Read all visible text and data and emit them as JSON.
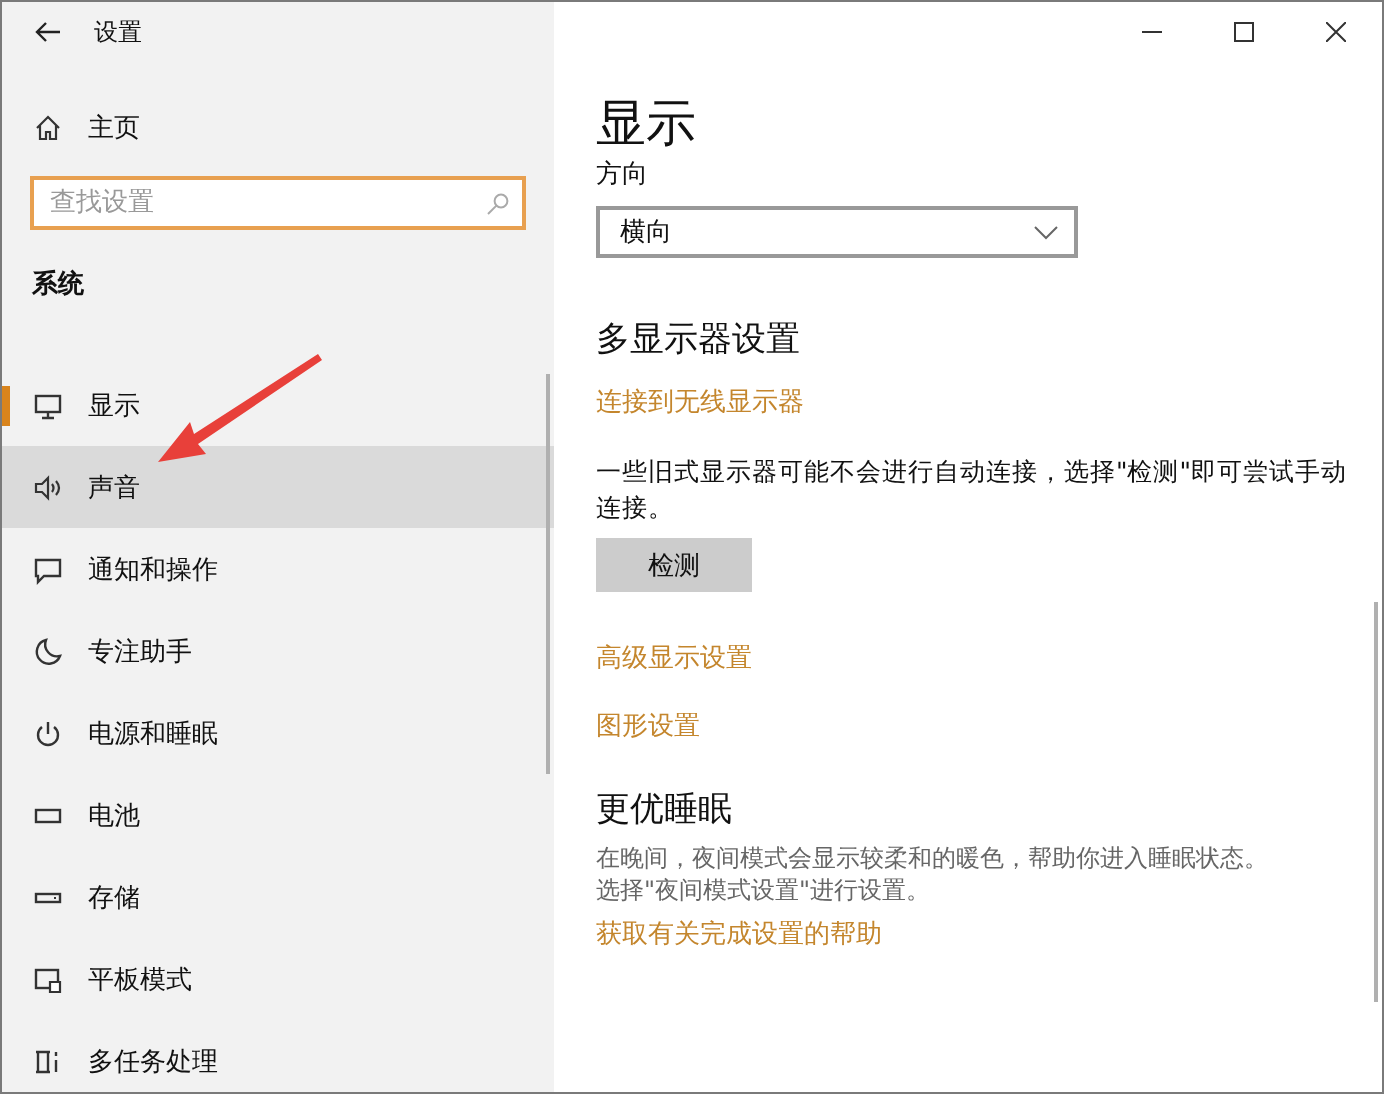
{
  "window": {
    "title": "设置"
  },
  "sidebar": {
    "home": "主页",
    "search": {
      "placeholder": "查找设置",
      "focused": true
    },
    "section": "系统",
    "items": [
      {
        "kind": "monitor",
        "label": "显示",
        "selected": true,
        "hover": false
      },
      {
        "kind": "speaker",
        "label": "声音",
        "selected": false,
        "hover": true
      },
      {
        "kind": "message",
        "label": "通知和操作",
        "selected": false,
        "hover": false
      },
      {
        "kind": "moon",
        "label": "专注助手",
        "selected": false,
        "hover": false
      },
      {
        "kind": "power",
        "label": "电源和睡眠",
        "selected": false,
        "hover": false
      },
      {
        "kind": "battery",
        "label": "电池",
        "selected": false,
        "hover": false
      },
      {
        "kind": "storage",
        "label": "存储",
        "selected": false,
        "hover": false
      },
      {
        "kind": "tablet",
        "label": "平板模式",
        "selected": false,
        "hover": false
      },
      {
        "kind": "multitask",
        "label": "多任务处理",
        "selected": false,
        "hover": false
      }
    ]
  },
  "content": {
    "title": "显示",
    "orientation": {
      "label": "方向",
      "value": "横向"
    },
    "multi_display": {
      "heading": "多显示器设置",
      "link": "连接到无线显示器",
      "note": "一些旧式显示器可能不会进行自动连接，选择\"检测\"即可尝试手动连接。",
      "button": "检测"
    },
    "links": [
      "高级显示设置",
      "图形设置"
    ],
    "night": {
      "heading": "更优睡眠",
      "description_lines": [
        "在晚间，夜间模式会显示较柔和的暖色，帮助你进入睡眠状态。",
        "选择\"夜间模式设置\"进行设置。"
      ],
      "link": "获取有关完成设置的帮助"
    }
  }
}
